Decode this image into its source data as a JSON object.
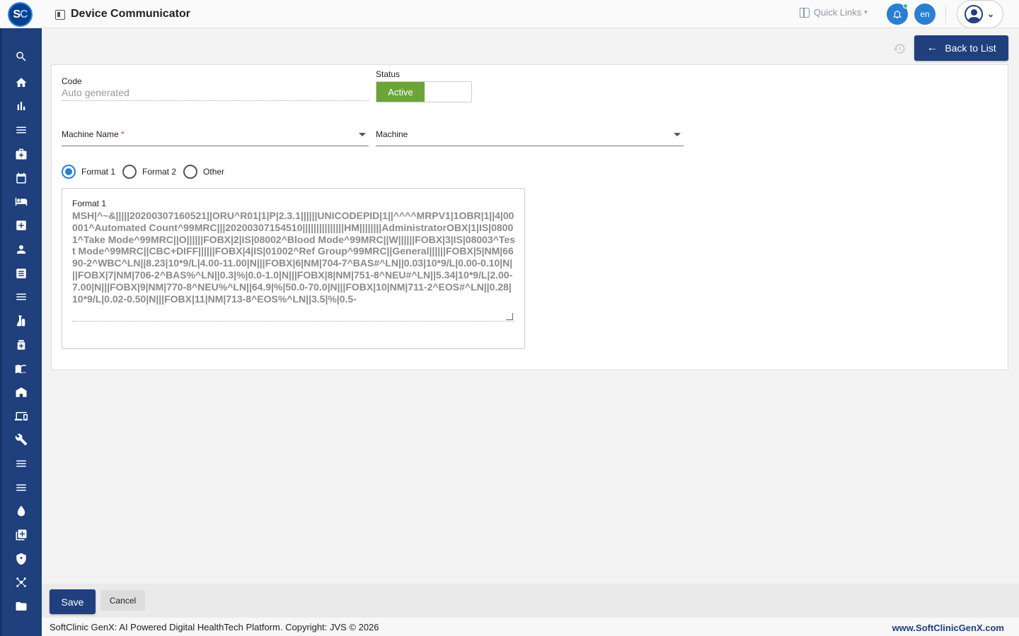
{
  "header": {
    "logo_text_s": "S",
    "logo_text_c": "C",
    "title": "Device Communicator",
    "quick_links": "Quick Links",
    "lang": "en"
  },
  "sidebar": {
    "items": [
      {
        "icon": "search-icon"
      },
      {
        "icon": "home-icon"
      },
      {
        "icon": "bar-chart-icon"
      },
      {
        "icon": "menu-icon"
      },
      {
        "icon": "medical-bag-icon"
      },
      {
        "icon": "calendar-icon"
      },
      {
        "icon": "bed-icon"
      },
      {
        "icon": "medical-plus-icon"
      },
      {
        "icon": "person-icon"
      },
      {
        "icon": "report-icon"
      },
      {
        "icon": "menu-icon"
      },
      {
        "icon": "lab-icon"
      },
      {
        "icon": "pharmacy-icon"
      },
      {
        "icon": "book-icon"
      },
      {
        "icon": "building-icon"
      },
      {
        "icon": "devices-icon"
      },
      {
        "icon": "wrench-icon"
      },
      {
        "icon": "menu-icon"
      },
      {
        "icon": "menu-icon"
      },
      {
        "icon": "blood-drop-icon"
      },
      {
        "icon": "add-box-icon"
      },
      {
        "icon": "shield-icon"
      },
      {
        "icon": "hub-icon"
      },
      {
        "icon": "folder-icon"
      }
    ]
  },
  "toolbar": {
    "back_label": "Back to List"
  },
  "form": {
    "code_label": "Code",
    "code_value": "Auto generated",
    "status_label": "Status",
    "status_active": "Active",
    "machine_name_label": "Machine Name",
    "machine_name_required": "*",
    "machine_label": "Machine",
    "radio_options": [
      "Format 1",
      "Format 2",
      "Other"
    ],
    "selected_format": "Format 1",
    "format_title": "Format 1",
    "format_text": "MSH|^~&|||||20200307160521||ORU^R01|1|P|2.3.1||||||UNICODEPID|1||^^^^MRPV1|1OBR|1||4|00001^Automated Count^99MRC|||20200307154510|||||||||||||||HM||||||||AdministratorOBX|1|IS|08001^Take Mode^99MRC||O||||||FOBX|2|IS|08002^Blood Mode^99MRC||W||||||FOBX|3|IS|08003^Test Mode^99MRC||CBC+DIFF||||||FOBX|4|IS|01002^Ref Group^99MRC||General||||||FOBX|5|NM|6690-2^WBC^LN||8.23|10*9/L|4.00-11.00|N|||FOBX|6|NM|704-7^BAS#^LN||0.03|10*9/L|0.00-0.10|N|||FOBX|7|NM|706-2^BAS%^LN||0.3|%|0.0-1.0|N|||FOBX|8|NM|751-8^NEU#^LN||5.34|10*9/L|2.00-7.00|N|||FOBX|9|NM|770-8^NEU%^LN||64.9|%|50.0-70.0|N|||FOBX|10|NM|711-2^EOS#^LN||0.28|10*9/L|0.02-0.50|N|||FOBX|11|NM|713-8^EOS%^LN||3.5|%|0.5-"
  },
  "actions": {
    "save": "Save",
    "cancel": "Cancel"
  },
  "footer": {
    "copyright": "SoftClinic GenX: AI Powered Digital HealthTech Platform. Copyright: JVS © 2026",
    "website": "www.SoftClinicGenX.com"
  },
  "colors": {
    "brand": "#1f3f7d",
    "accent": "#2a7fd4",
    "active": "#6ba539"
  }
}
